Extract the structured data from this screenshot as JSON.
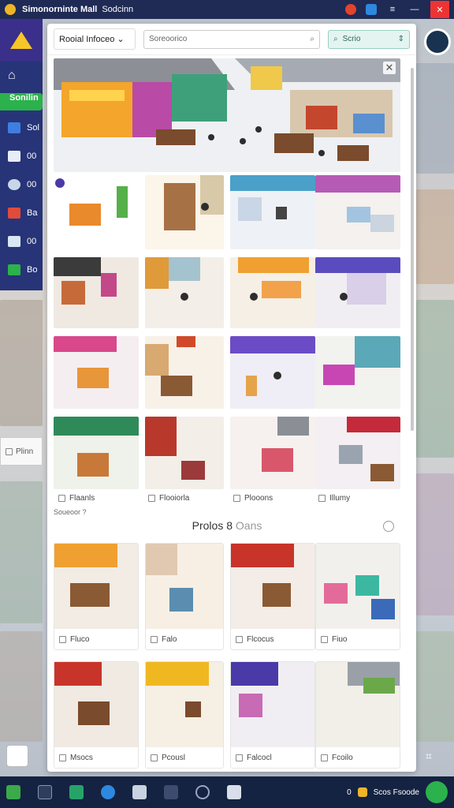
{
  "window": {
    "title": "Simonorninte Mall",
    "subtitle": "Sodcinn"
  },
  "sidebar": {
    "active_label": "Sonilin",
    "items": [
      {
        "label": "Sol",
        "color": "#3f7ee0"
      },
      {
        "label": "00",
        "color": "#e8eef7"
      },
      {
        "label": "00",
        "color": "#c9d6ea"
      },
      {
        "label": "Ba",
        "color": "#e04b3b"
      },
      {
        "label": "00",
        "color": "#d9e6f3"
      },
      {
        "label": "Bo",
        "color": "#2bb24c"
      }
    ]
  },
  "toolbar": {
    "dropdown_label": "Rooial Infoceo",
    "search_placeholder": "Soreoorico",
    "button_label": "Scrio"
  },
  "grid": {
    "labels": [
      "Flaanls",
      "Flooiorla",
      "Plooons",
      "Illumy"
    ],
    "footnote": "Soueoor ?"
  },
  "section": {
    "title_dark": "Prolos 8",
    "title_muted": "Oans"
  },
  "cards": {
    "row1": [
      "Fluco",
      "Falo",
      "Flcocus",
      "Fiuo"
    ],
    "row2": [
      "Msocs",
      "Pcousl",
      "Falcocl",
      "Fcoilo"
    ]
  },
  "side_card": {
    "label": "Plinn"
  },
  "taskbar": {
    "right_text": "Scos Fsoode",
    "left_label": "0"
  },
  "colors": {
    "titlebar": "#1f2a55",
    "sidebar": "#273478",
    "accent_green": "#2bb24c",
    "taskbar": "#142341"
  }
}
